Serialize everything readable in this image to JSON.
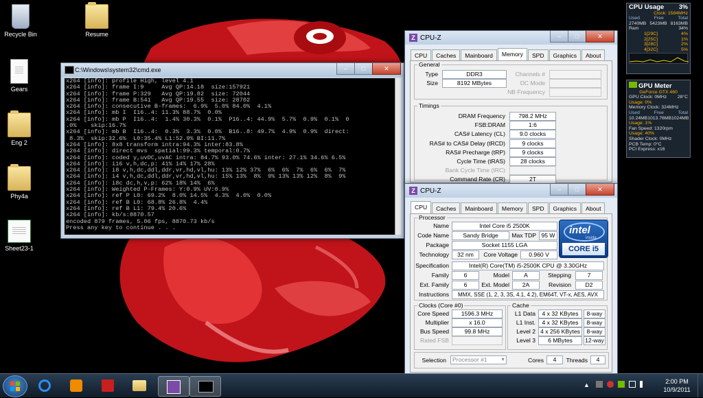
{
  "desktop": {
    "icons": [
      {
        "label": "Recycle Bin",
        "icon": "recycle-bin-icon"
      },
      {
        "label": "Resume",
        "icon": "folder-icon"
      },
      {
        "label": "Gears",
        "icon": "document-icon"
      },
      {
        "label": "Eng 2",
        "icon": "folder-icon"
      },
      {
        "label": "Phy4a",
        "icon": "folder-icon"
      },
      {
        "label": "Sheet23-1",
        "icon": "excel-file-icon"
      }
    ]
  },
  "cmd": {
    "title": "C:\\Windows\\system32\\cmd.exe",
    "lines": [
      "x264 [info]: profile High, level 4.1",
      "x264 [info]: frame I:9     Avg QP:14.18  size:157921",
      "x264 [info]: frame P:329   Avg QP:19.82  size: 72044",
      "x264 [info]: frame B:541   Avg QP:19.55  size: 28702",
      "x264 [info]: consecutive B-frames:  6.9%  5.0% 84.0%  4.1%",
      "x264 [info]: mb I  I16..4: 11.3% 88.7%  0.0%",
      "x264 [info]: mb P  I16..4:  1.4% 30.3%  0.1%  P16..4: 44.9%  5.7%  0.9%  0.1%  0",
      ".0%    skip:16.7%",
      "x264 [info]: mb B  I16..4:  0.3%  3.3%  0.0%  B16..8: 49.7%  4.9%  0.9%  direct:",
      " 8.3%  skip:32.6%  L0:35.4% L1:52.9% BI:11.7%",
      "x264 [info]: 8x8 transform intra:94.3% inter:83.8%",
      "x264 [info]: direct mvs  spatial:99.3% temporal:0.7%",
      "x264 [info]: coded y,uvDC,uvAC intra: 84.7% 93.0% 74.6% inter: 27.1% 34.6% 6.5%",
      "x264 [info]: i16 v,h,dc,p: 41% 14% 17% 28%",
      "x264 [info]: i8 v,h,dc,ddl,ddr,vr,hd,vl,hu: 13% 12% 37%  6%  6%  7%  6%  6%  7%",
      "x264 [info]: i4 v,h,dc,ddl,ddr,vr,hd,vl,hu: 15% 13%  8%  9% 13% 13% 12%  8%  9%",
      "x264 [info]: i8c dc,h,v,p: 62% 18% 14%  6%",
      "x264 [info]: Weighted P-Frames: Y:0.9% UV:0.9%",
      "x264 [info]: ref P L0: 69.2%  8.0% 14.5%  4.3%  4.0%  0.0%",
      "x264 [info]: ref B L0: 68.8% 26.8%  4.4%",
      "x264 [info]: ref B L1: 79.4% 20.6%",
      "x264 [info]: kb/s:8870.57",
      "",
      "encoded 879 frames, 5.06 fps, 8870.73 kb/s",
      "Press any key to continue . . ."
    ]
  },
  "cpuz_memory": {
    "title": "CPU-Z",
    "tabs": [
      "CPU",
      "Caches",
      "Mainboard",
      "Memory",
      "SPD",
      "Graphics",
      "About"
    ],
    "active_tab": "Memory",
    "general": {
      "legend": "General",
      "type_label": "Type",
      "type_value": "DDR3",
      "size_label": "Size",
      "size_value": "8192 MBytes",
      "channels_label": "Channels #",
      "dc_mode_label": "DC Mode",
      "nb_freq_label": "NB Frequency"
    },
    "timings": {
      "legend": "Timings",
      "rows": [
        {
          "label": "DRAM Frequency",
          "value": "798.2 MHz"
        },
        {
          "label": "FSB:DRAM",
          "value": "1:6"
        },
        {
          "label": "CAS# Latency (CL)",
          "value": "9.0 clocks"
        },
        {
          "label": "RAS# to CAS# Delay (tRCD)",
          "value": "9 clocks"
        },
        {
          "label": "RAS# Precharge (tRP)",
          "value": "9 clocks"
        },
        {
          "label": "Cycle Time (tRAS)",
          "value": "28 clocks"
        },
        {
          "label": "Bank Cycle Time (tRC)",
          "value": ""
        },
        {
          "label": "Command Rate (CR)",
          "value": "2T"
        }
      ]
    }
  },
  "cpuz_cpu": {
    "title": "CPU-Z",
    "tabs": [
      "CPU",
      "Caches",
      "Mainboard",
      "Memory",
      "SPD",
      "Graphics",
      "About"
    ],
    "active_tab": "CPU",
    "processor": {
      "legend": "Processor",
      "name_label": "Name",
      "name": "Intel Core i5 2500K",
      "codename_label": "Code Name",
      "codename": "Sandy Bridge",
      "maxtdp_label": "Max TDP",
      "maxtdp": "95 W",
      "package_label": "Package",
      "package": "Socket 1155 LGA",
      "technology_label": "Technology",
      "technology": "32 nm",
      "corevoltage_label": "Core Voltage",
      "corevoltage": "0.960 V",
      "spec_label": "Specification",
      "spec": "Intel(R) Core(TM) i5-2500K CPU @ 3.30GHz",
      "family_label": "Family",
      "family": "6",
      "model_label": "Model",
      "model": "A",
      "stepping_label": "Stepping",
      "stepping": "7",
      "extfamily_label": "Ext. Family",
      "extfamily": "6",
      "extmodel_label": "Ext. Model",
      "extmodel": "2A",
      "revision_label": "Revision",
      "revision": "D2",
      "instructions_label": "Instructions",
      "instructions": "MMX, SSE (1, 2, 3, 3S, 4.1, 4.2), EM64T, VT-x, AES, AVX"
    },
    "intel_badge": {
      "brand": "intel",
      "inside": "inside",
      "line": "CORE i5"
    },
    "clocks": {
      "legend": "Clocks (Core #0)",
      "corespeed_label": "Core Speed",
      "corespeed": "1596.3 MHz",
      "multiplier_label": "Multiplier",
      "multiplier": "x 16.0",
      "busspeed_label": "Bus Speed",
      "busspeed": "99.8 MHz",
      "ratedfsb_label": "Rated FSB"
    },
    "cache": {
      "legend": "Cache",
      "rows": [
        {
          "label": "L1 Data",
          "size": "4 x 32 KBytes",
          "way": "8-way"
        },
        {
          "label": "L1 Inst.",
          "size": "4 x 32 KBytes",
          "way": "8-way"
        },
        {
          "label": "Level 2",
          "size": "4 x 256 KBytes",
          "way": "8-way"
        },
        {
          "label": "Level 3",
          "size": "6 MBytes",
          "way": "12-way"
        }
      ]
    },
    "selection_label": "Selection",
    "selection": "Processor #1",
    "cores_label": "Cores",
    "cores": "4",
    "threads_label": "Threads",
    "threads": "4"
  },
  "cpu_gadget": {
    "title": "CPU Usage",
    "usage": "3%",
    "clock": "Clock: 1584MHz",
    "h_used": "Used",
    "h_free": "Free",
    "h_total": "Total",
    "used": "2740MB",
    "free": "5423MB",
    "total": "8163MB",
    "ram_label": "Ram",
    "ram_pct": "34%",
    "cores": [
      {
        "label": "1[29C]",
        "pct": "4%"
      },
      {
        "label": "2[25C]",
        "pct": "1%"
      },
      {
        "label": "3[28C]",
        "pct": "2%"
      },
      {
        "label": "4[32C]",
        "pct": "5%"
      }
    ]
  },
  "gpu_gadget": {
    "title": "GPU Meter",
    "model": "GeForce GTX 460",
    "clock": "GPU Clock: 0MHz",
    "temp": "28°C",
    "usage": "Usage: 0%",
    "memclock": "Memory Clock: 324MHz",
    "h_used": "Used",
    "h_free": "Free",
    "h_total": "Total",
    "used": "10.24MB",
    "free": "1013.76MB",
    "total": "1024MB",
    "mem_usage": "Usage: 1%",
    "fan": "Fan Speed: 1320rpm",
    "fan_usage": "Usage: 40%",
    "shader": "Shader Clock: 0MHz",
    "pcb": "PCB Temp: 0°C",
    "pci": "PCI Express: x16"
  },
  "taskbar": {
    "time": "2:00 PM",
    "date": "10/9/2011"
  }
}
